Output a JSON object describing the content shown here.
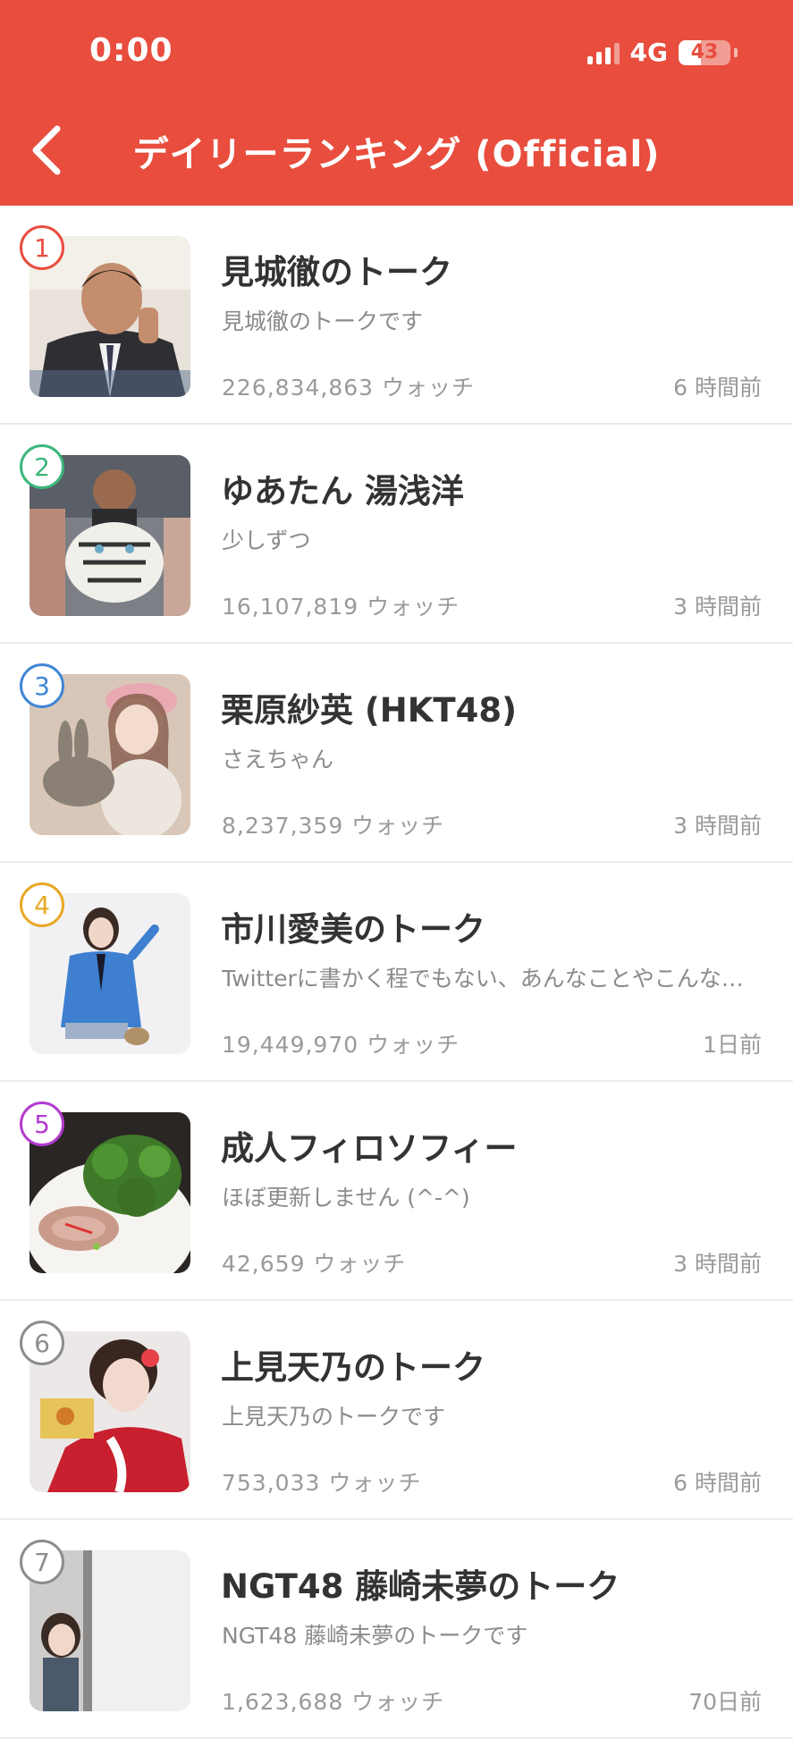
{
  "status": {
    "time": "0:00",
    "network": "4G",
    "battery": "43",
    "battery_level": 0.43
  },
  "header": {
    "title": "デイリーランキング (Official)"
  },
  "colors": {
    "header_bg": "#e84d3d"
  },
  "rows": [
    {
      "rank": "1",
      "rank_color": "#e84d3d",
      "name": "見城徹のトーク",
      "desc": "見城徹のトークです",
      "watch": "226,834,863 ウォッチ",
      "ago": "6 時間前"
    },
    {
      "rank": "2",
      "rank_color": "#3bb67a",
      "name": "ゆあたん 湯浅洋",
      "desc": "少しずつ",
      "watch": "16,107,819 ウォッチ",
      "ago": "3 時間前"
    },
    {
      "rank": "3",
      "rank_color": "#3f86d6",
      "name": "栗原紗英 (HKT48)",
      "desc": "さえちゃん",
      "watch": "8,237,359 ウォッチ",
      "ago": "3 時間前"
    },
    {
      "rank": "4",
      "rank_color": "#e9a825",
      "name": "市川愛美のトーク",
      "desc": "Twitterに書かく程でもない、あんなことやこんなこと",
      "watch": "19,449,970 ウォッチ",
      "ago": "1日前"
    },
    {
      "rank": "5",
      "rank_color": "#b43ad0",
      "name": "成人フィロソフィー",
      "desc": "ほぼ更新しません (^-^)",
      "watch": "42,659 ウォッチ",
      "ago": "3 時間前"
    },
    {
      "rank": "6",
      "rank_color": "#8d8d8d",
      "name": "上見天乃のトーク",
      "desc": "上見天乃のトークです",
      "watch": "753,033 ウォッチ",
      "ago": "6 時間前"
    },
    {
      "rank": "7",
      "rank_color": "#8d8d8d",
      "name": "NGT48 藤崎未夢のトーク",
      "desc": "NGT48 藤崎未夢のトークです",
      "watch": "1,623,688 ウォッチ",
      "ago": "70日前"
    }
  ]
}
